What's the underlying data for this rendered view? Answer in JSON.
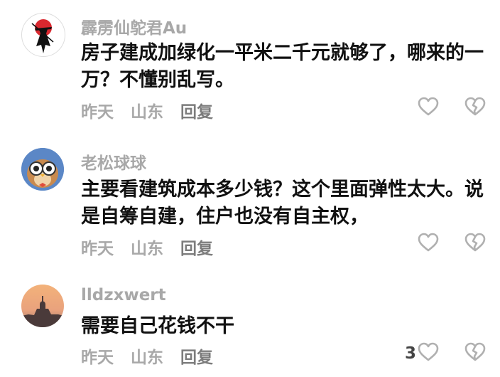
{
  "comments": [
    {
      "username": "霹雳仙鸵君Au",
      "text": "房子建成加绿化一平米二千元就够了，哪来的一万？不懂别乱写。",
      "time": "昨天",
      "location": "山东",
      "reply_label": "回复",
      "likes": "",
      "avatar": "warrior-avatar"
    },
    {
      "username": "老松球球",
      "text": "主要看建筑成本多少钱？这个里面弹性太大。说是自筹自建，住户也没有自主权，",
      "time": "昨天",
      "location": "山东",
      "reply_label": "回复",
      "likes": "",
      "avatar": "owl-avatar"
    },
    {
      "username": "lldzxwert",
      "text": "需要自己花钱不干",
      "time": "昨天",
      "location": "山东",
      "reply_label": "回复",
      "likes": "3",
      "avatar": "sunset-cathedral-avatar"
    }
  ],
  "icons": {
    "like": "heart-outline-icon",
    "dislike": "broken-heart-outline-icon"
  },
  "colors": {
    "text": "#111111",
    "muted": "#a8a8a8",
    "icon": "#b0b0b0"
  }
}
